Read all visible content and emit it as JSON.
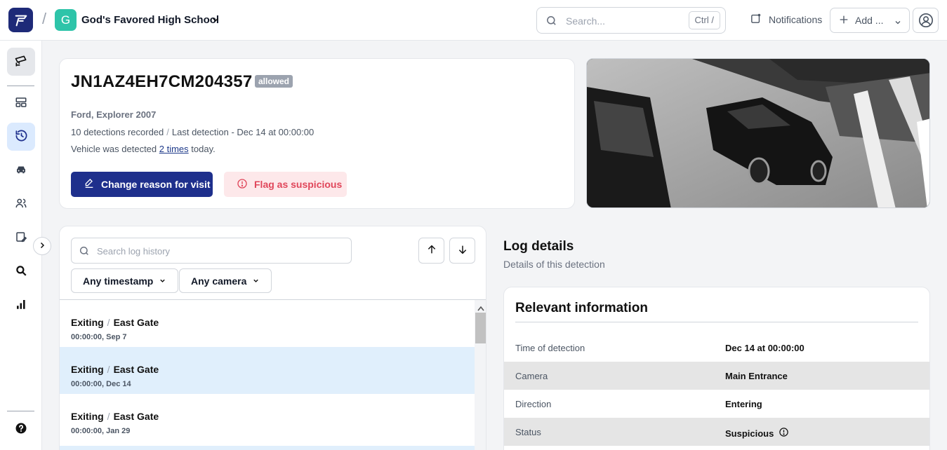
{
  "header": {
    "org_initial": "G",
    "org_name": "God's Favored High School",
    "search_placeholder": "Search...",
    "search_shortcut": "Ctrl /",
    "notifications_label": "Notifications",
    "add_label": "Add ..."
  },
  "sidebar": {
    "items": [
      {
        "name": "cameras",
        "icon": "camera-icon"
      },
      {
        "name": "dashboard",
        "icon": "layout-icon"
      },
      {
        "name": "history",
        "icon": "history-icon"
      },
      {
        "name": "vehicles",
        "icon": "car-icon"
      },
      {
        "name": "people",
        "icon": "users-icon"
      },
      {
        "name": "visits",
        "icon": "clipboard-pen-icon"
      },
      {
        "name": "search",
        "icon": "search-icon"
      },
      {
        "name": "analytics",
        "icon": "bar-chart-icon"
      },
      {
        "name": "help",
        "icon": "help-icon"
      }
    ]
  },
  "vehicle": {
    "plate": "JN1AZ4EH7CM204357",
    "status_badge": "allowed",
    "make_model": "Ford, Explorer 2007",
    "detections": "10 detections recorded",
    "last_detection": "Last detection - Dec 14 at 00:00:00",
    "detected_prefix": "Vehicle was detected",
    "detected_link": "2 times",
    "detected_suffix": "today.",
    "change_reason_label": "Change reason for visit",
    "flag_label": "Flag as suspicious"
  },
  "log": {
    "search_placeholder": "Search log history",
    "filter_timestamp": "Any timestamp",
    "filter_camera": "Any camera",
    "entries": [
      {
        "direction": "Exiting",
        "camera": "East Gate",
        "time": "00:00:00, Sep 7"
      },
      {
        "direction": "Exiting",
        "camera": "East Gate",
        "time": "00:00:00, Dec 14"
      },
      {
        "direction": "Exiting",
        "camera": "East Gate",
        "time": "00:00:00, Jan 29"
      }
    ]
  },
  "details": {
    "title": "Log details",
    "subtitle": "Details of this detection",
    "card_title": "Relevant information",
    "rows": [
      {
        "label": "Time of detection",
        "value": "Dec 14 at 00:00:00"
      },
      {
        "label": "Camera",
        "value": "Main Entrance"
      },
      {
        "label": "Direction",
        "value": "Entering"
      },
      {
        "label": "Status",
        "value": "Suspicious"
      }
    ]
  },
  "colors": {
    "brand": "#1e2f8c",
    "org_badge": "#2ec4a9",
    "danger": "#e0465a",
    "selected_row": "#e0effc"
  }
}
